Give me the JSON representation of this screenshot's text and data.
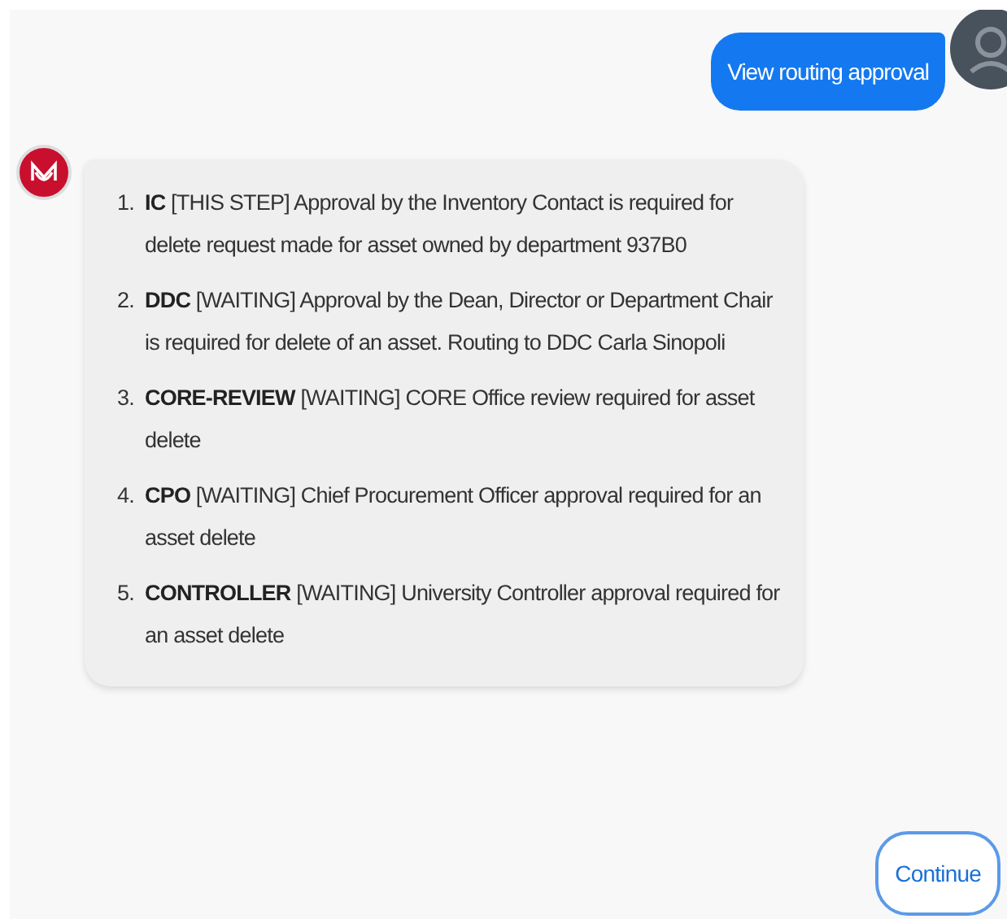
{
  "user_message": {
    "text": "View routing approval"
  },
  "bot_message": {
    "steps": [
      {
        "number": "1.",
        "text": "**IC** [THIS STEP] Approval by the Inventory Contact is required for delete request made for asset owned by department 937B0"
      },
      {
        "number": "2.",
        "text": "**DDC** [WAITING] Approval by the Dean, Director or Department Chair is required for delete of an asset. Routing to DDC Carla Sinopoli"
      },
      {
        "number": "3.",
        "text": "**CORE-REVIEW** [WAITING] CORE Office review required for asset delete"
      },
      {
        "number": "4.",
        "text": "**CPO** [WAITING] Chief Procurement Officer approval required for an asset delete"
      },
      {
        "number": "5.",
        "text": "**CONTROLLER** [WAITING] University Controller approval required for an asset delete"
      }
    ]
  },
  "buttons": [
    {
      "label": "Continue"
    }
  ]
}
